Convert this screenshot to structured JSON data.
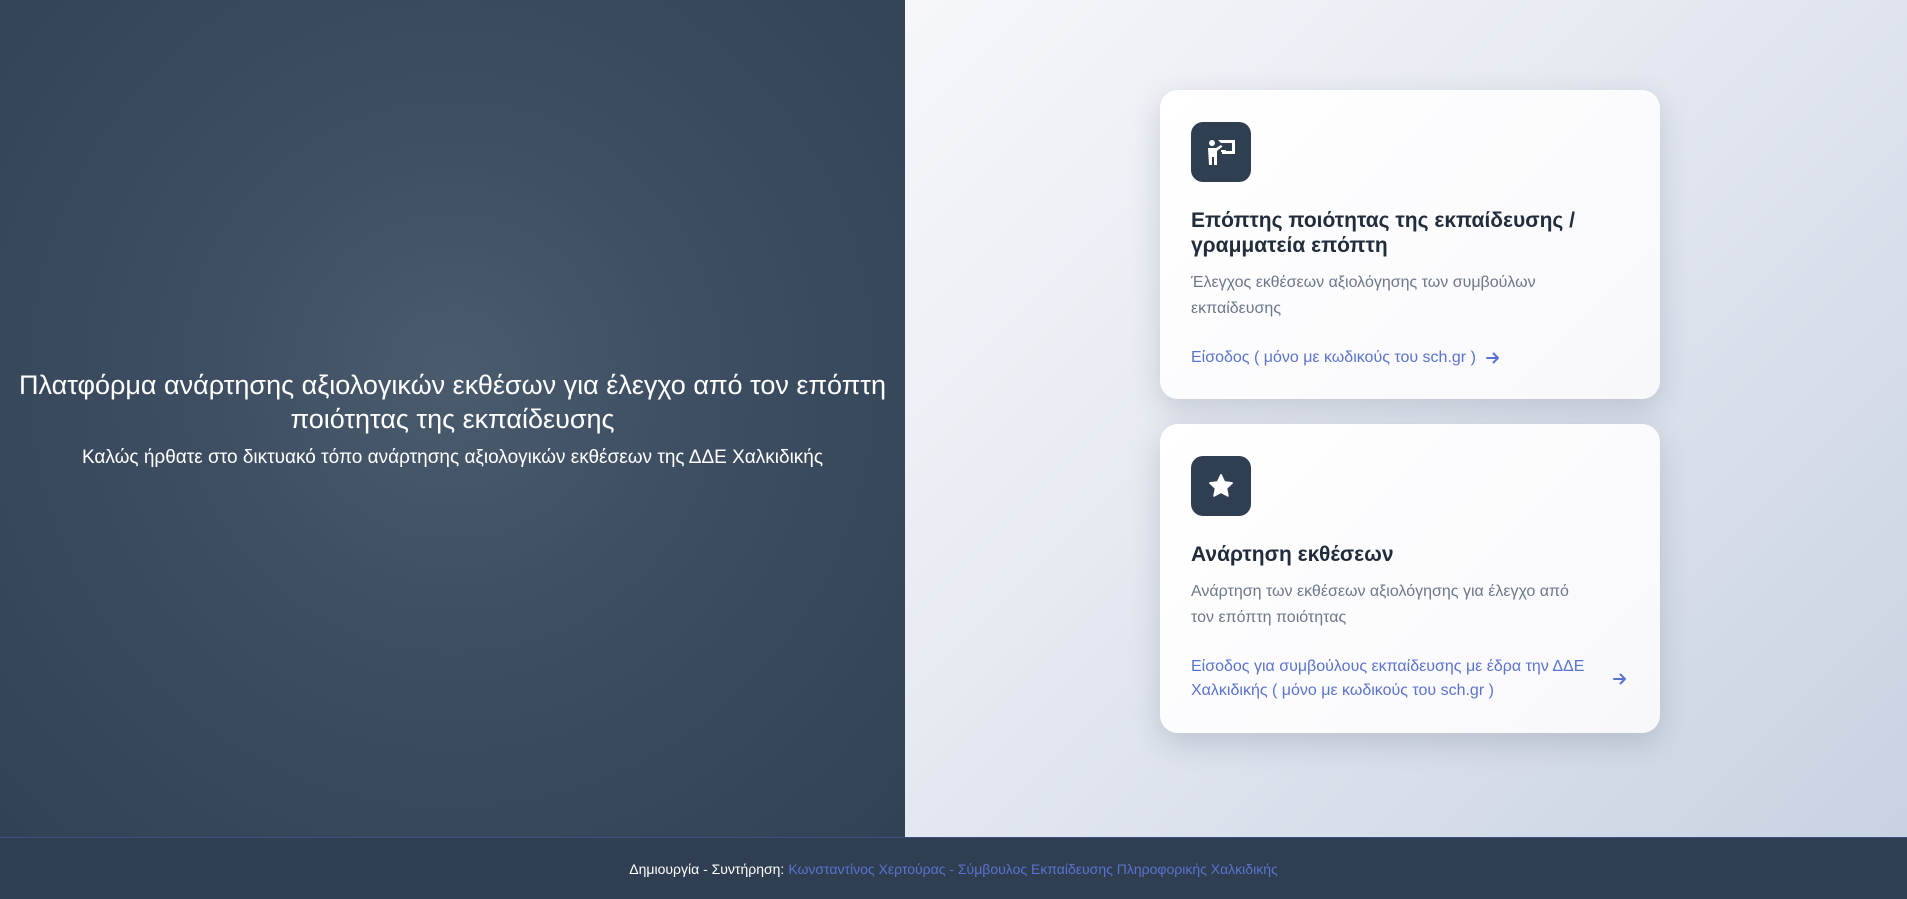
{
  "hero": {
    "title": "Πλατφόρμα ανάρτησης αξιολογικών εκθέσων για έλεγχο από τον επόπτη ποιότητας της εκπαίδευσης",
    "subtitle": "Καλώς ήρθατε στο δικτυακό τόπο ανάρτησης αξιολογικών εκθέσεων της ΔΔΕ Χαλκιδικής"
  },
  "cards": [
    {
      "icon": "teacher-board-icon",
      "title": "Επόπτης ποιότητας της εκπαίδευσης / γραμματεία επόπτη",
      "description": "Έλεγχος εκθέσεων αξιολόγησης των συμβούλων εκπαίδευσης",
      "link": "Είσοδος ( μόνο με κωδικούς του sch.gr )"
    },
    {
      "icon": "star-icon",
      "title": "Ανάρτηση εκθέσεων",
      "description": "Ανάρτηση των εκθέσεων αξιολόγησης για έλεγχο από τον επόπτη ποιότητας",
      "link": "Είσοδος για συμβούλους εκπαίδευσης με έδρα την ΔΔΕ Χαλκιδικής ( μόνο με κωδικούς του sch.gr )"
    }
  ],
  "footer": {
    "label": "Δημιουργία - Συντήρηση:",
    "link": "Κωνσταντίνος Χερτούρας - Σύμβουλος Εκπαίδευσης Πληροφορικής Χαλκιδικής"
  },
  "colors": {
    "dark_panel": "#2f3e51",
    "accent_link": "#5a73d0",
    "card_title": "#222d3c",
    "card_text": "#6c778a"
  }
}
